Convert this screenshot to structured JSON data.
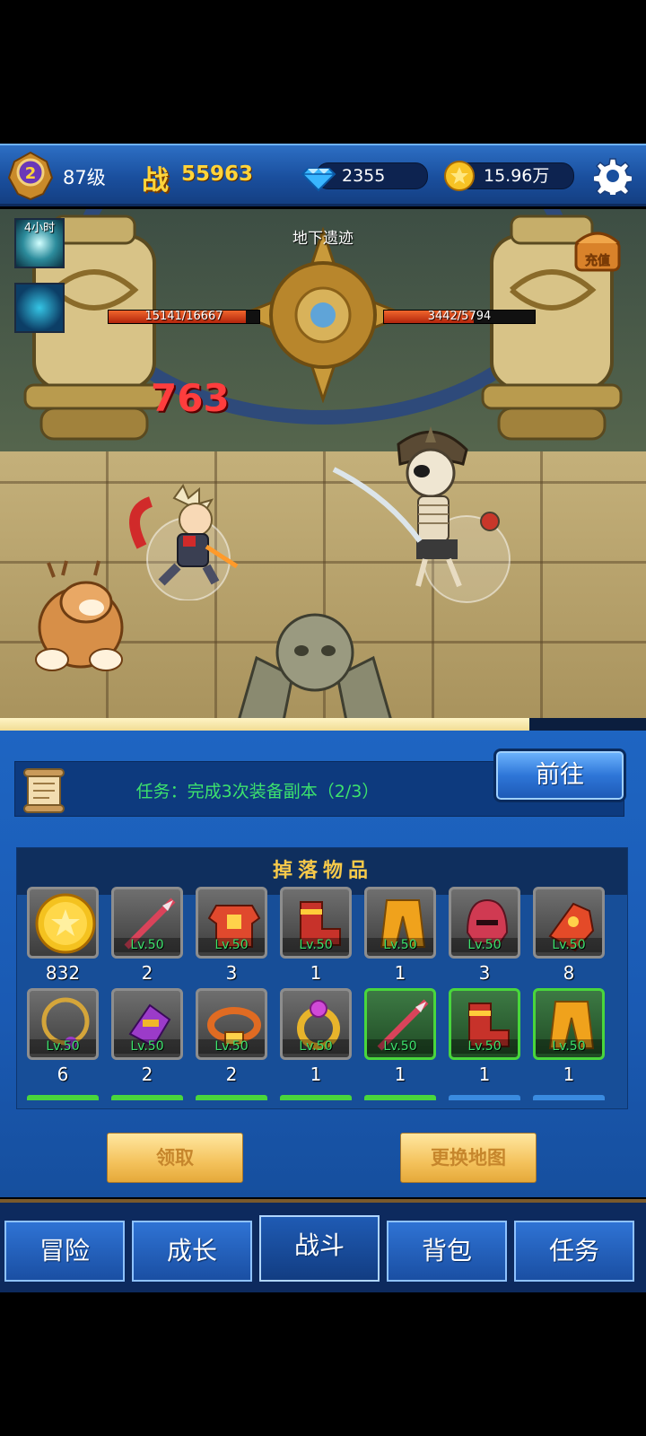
{
  "player": {
    "rank": "2",
    "level": "87级",
    "power_label": "战",
    "power_value": "55963",
    "gems": "2355",
    "gold": "15.96万"
  },
  "battle": {
    "location": "地下遗迹",
    "buff_timer": "4小时",
    "chest_label": "充值",
    "hero_hp_text": "15141/16667",
    "hero_hp_fraction": 0.908,
    "enemy_hp_text": "3442/5794",
    "enemy_hp_fraction": 0.594,
    "damage": "763",
    "stage_progress_fraction": 0.82
  },
  "quest": {
    "text": "任务：完成3次装备副本（2/3）",
    "goto_label": "前往"
  },
  "drops": {
    "title": "掉落物品",
    "items": [
      {
        "icon": "gold-coin-icon",
        "lv": "",
        "count": "832",
        "rarity": "gray",
        "color": "#f4c21f"
      },
      {
        "icon": "spear-icon",
        "lv": "Lv.50",
        "count": "2",
        "rarity": "gray",
        "color": "#d9435a"
      },
      {
        "icon": "armor-icon",
        "lv": "Lv.50",
        "count": "3",
        "rarity": "gray",
        "color": "#e0492d"
      },
      {
        "icon": "boots-icon",
        "lv": "Lv.50",
        "count": "1",
        "rarity": "gray",
        "color": "#c7322a"
      },
      {
        "icon": "pants-icon",
        "lv": "Lv.50",
        "count": "1",
        "rarity": "gray",
        "color": "#f0a21c"
      },
      {
        "icon": "helmet-icon",
        "lv": "Lv.50",
        "count": "3",
        "rarity": "gray",
        "color": "#d03a52"
      },
      {
        "icon": "gauntlet-icon",
        "lv": "Lv.50",
        "count": "8",
        "rarity": "gray",
        "color": "#e44a28"
      },
      {
        "icon": "necklace-icon",
        "lv": "Lv.50",
        "count": "6",
        "rarity": "gray",
        "color": "#d4a53a"
      },
      {
        "icon": "bracer-icon",
        "lv": "Lv.50",
        "count": "2",
        "rarity": "gray",
        "color": "#9b3bc9"
      },
      {
        "icon": "belt-icon",
        "lv": "Lv.50",
        "count": "2",
        "rarity": "gray",
        "color": "#e06b22"
      },
      {
        "icon": "ring-icon",
        "lv": "Lv.50",
        "count": "1",
        "rarity": "gray",
        "color": "#e8b42b"
      },
      {
        "icon": "spear-icon",
        "lv": "Lv.50",
        "count": "1",
        "rarity": "green",
        "color": "#d9435a"
      },
      {
        "icon": "boots-icon",
        "lv": "Lv.50",
        "count": "1",
        "rarity": "green",
        "color": "#c7322a"
      },
      {
        "icon": "pants-icon",
        "lv": "Lv.50",
        "count": "1",
        "rarity": "green",
        "color": "#f0a21c"
      }
    ]
  },
  "actions": {
    "claim_label": "领取",
    "change_map_label": "更换地图"
  },
  "nav": {
    "tabs": [
      "冒险",
      "成长",
      "战斗",
      "背包",
      "任务"
    ],
    "active_tab": "战斗"
  },
  "colors": {
    "accent_gold": "#ffd43a",
    "quest_green": "#3de26d",
    "panel_blue": "#1a5ab3"
  }
}
